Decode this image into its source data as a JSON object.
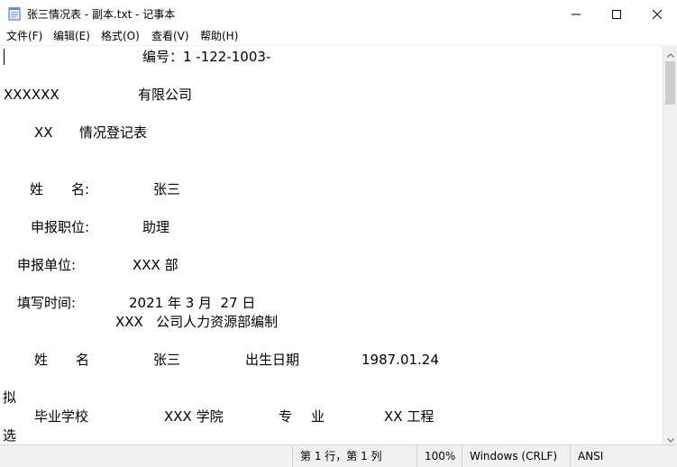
{
  "window": {
    "title": "张三情况表 - 副本.txt - 记事本",
    "app_icon": "notepad-icon",
    "controls": [
      "minimize-icon",
      "maximize-icon",
      "close-icon"
    ]
  },
  "menu": {
    "file": "文件(F)",
    "edit": "编辑(E)",
    "format": "格式(O)",
    "view": "查看(V)",
    "help": "帮助(H)"
  },
  "document": {
    "lines": [
      "编号：1 -122-1003-",
      "XXXXXX",
      "有限公司",
      "XX",
      "情况登记表",
      "姓",
      "名:",
      "张三",
      "申报职位:",
      "助理",
      "申报单位:",
      "XXX 部",
      "填写时间:",
      "2021 年 3 月  27 日",
      "XXX   公司人力资源部编制",
      "姓",
      "名",
      "张三",
      "出生日期",
      "1987.01.24",
      "拟",
      "毕业学校",
      "XXX 学院",
      "专",
      "业",
      "XX 工程",
      "选"
    ]
  },
  "status": {
    "position": "第 1 行，第 1 列",
    "zoom": "100%",
    "line_ending": "Windows (CRLF)",
    "encoding": "ANSI"
  },
  "colors": {
    "window_bg": "#ffffff",
    "statusbar_bg": "#f0f0f0",
    "scrollbar_thumb": "#cdcdcd"
  }
}
